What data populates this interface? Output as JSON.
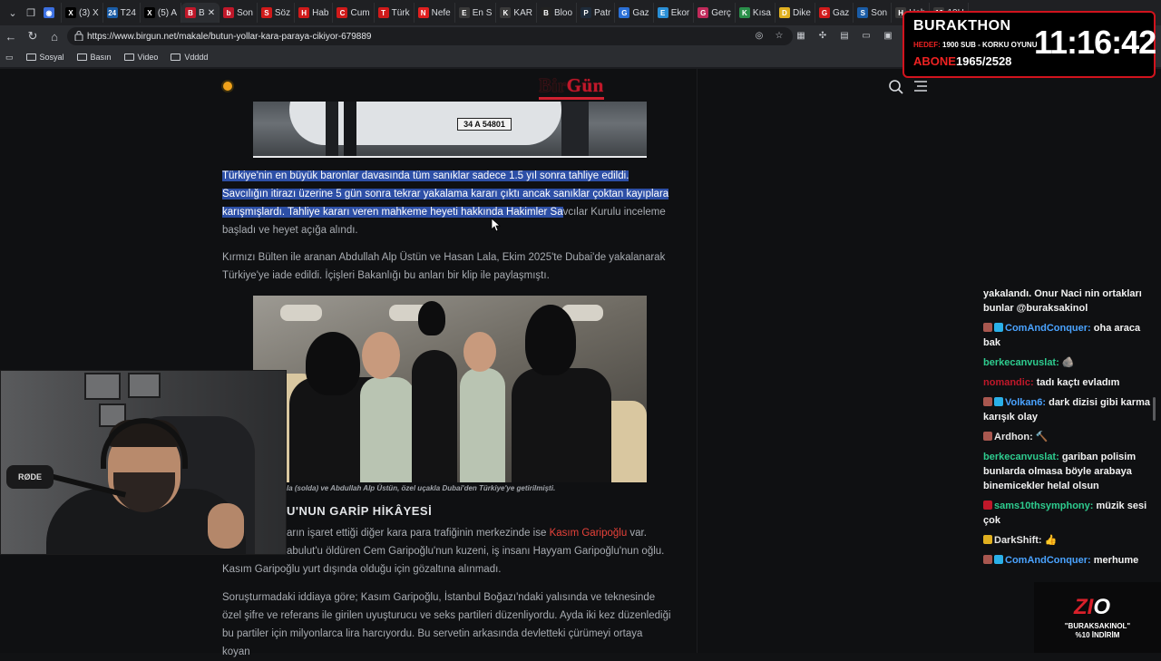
{
  "browser": {
    "tabs": [
      {
        "label": "",
        "color": "#3b6fe0",
        "glyph": "◉"
      },
      {
        "label": "(3) X",
        "color": "#000000",
        "glyph": "X"
      },
      {
        "label": "T24",
        "color": "#1a5ca6",
        "glyph": "24"
      },
      {
        "label": "(5) A",
        "color": "#000000",
        "glyph": "X"
      },
      {
        "label": "B",
        "color": "#c0182a",
        "glyph": "B",
        "active": true
      },
      {
        "label": "Son",
        "color": "#c0182a",
        "glyph": "b"
      },
      {
        "label": "Söz",
        "color": "#d01a1a",
        "glyph": "S"
      },
      {
        "label": "Hab",
        "color": "#d01a1a",
        "glyph": "H"
      },
      {
        "label": "Cum",
        "color": "#d01a1a",
        "glyph": "C"
      },
      {
        "label": "Türk",
        "color": "#d01a1a",
        "glyph": "T"
      },
      {
        "label": "Nefe",
        "color": "#e02020",
        "glyph": "N"
      },
      {
        "label": "En S",
        "color": "#3a3a3a",
        "glyph": "E"
      },
      {
        "label": "KAR",
        "color": "#3a3a3a",
        "glyph": "K"
      },
      {
        "label": "Bloo",
        "color": "#222222",
        "glyph": "B"
      },
      {
        "label": "Patr",
        "color": "#1e2b3a",
        "glyph": "P"
      },
      {
        "label": "Gaz",
        "color": "#2a6fd6",
        "glyph": "G"
      },
      {
        "label": "Ekor",
        "color": "#2a8fd6",
        "glyph": "E"
      },
      {
        "label": "Gerç",
        "color": "#c02a5a",
        "glyph": "G"
      },
      {
        "label": "Kısa",
        "color": "#2a8f4a",
        "glyph": "K"
      },
      {
        "label": "Dike",
        "color": "#e0b020",
        "glyph": "D"
      },
      {
        "label": "Gaz",
        "color": "#d01a1a",
        "glyph": "G"
      },
      {
        "label": "Son",
        "color": "#1a5ca6",
        "glyph": "S"
      },
      {
        "label": "Hab",
        "color": "#3a3a3a",
        "glyph": "H"
      },
      {
        "label": "10H",
        "color": "#3a3a3a",
        "glyph": "10"
      }
    ],
    "url": "https://www.birgun.net/makale/butun-yollar-kara-paraya-cikiyor-679889",
    "bookmarks": [
      "Sosyal",
      "Basın",
      "Video",
      "Vdddd"
    ]
  },
  "site": {
    "logo_prefix": "Bir",
    "logo_suffix": "Gün",
    "plate": "34 A 54801"
  },
  "article": {
    "p1_highlight": "Türkiye'nin en büyük baronlar davasında tüm sanıklar sadece 1.5 yıl sonra tahliye edildi. Savcılığın itirazı üzerine 5 gün sonra tekrar yakalama kararı çıktı ancak sanıklar çoktan kayıplara karışmışlardı. Tahliye kararı veren mahkeme heyeti hakkında Hakimler Sa",
    "p1_rest": "vcılar Kurulu inceleme başladı ve heyet açığa alındı.",
    "p2": "Kırmızı Bülten ile aranan Abdullah Alp Üstün ve Hasan Lala, Ekim 2025'te Dubai'de yakalanarak Türkiye'ye iade edildi. İçişleri Bakanlığı bu anları bir klip ile paylaşmıştı.",
    "caption": "la (solda) ve Abdullah Alp Üstün, özel uçakla Dubai'den Türkiye'ye getirilmişti.",
    "heading": "U'NUN GARİP HİKÂYESİ",
    "p3_a": "arın işaret ettiği diğer kara para trafiğinin merkezinde ise ",
    "p3_link": "Kasım Garipoğlu",
    "p3_b": " var.",
    "p3_c": "abulut'u öldüren Cem Garipoğlu'nun kuzeni, iş insanı Hayyam Garipoğlu'nun oğlu.",
    "p3_d": "Kasım Garipoğlu yurt dışında olduğu için gözaltına alınmadı.",
    "p4": "Soruşturmadaki iddiaya göre; Kasım Garipoğlu, İstanbul Boğazı'ndaki yalısında ve teknesinde özel şifre ve referans ile girilen uyuşturucu ve seks partileri düzenliyordu. Ayda iki kez düzenlediği bu partiler için milyonlarca lira harcıyordu. Bu servetin arkasında devletteki çürümeyi ortaya koyan"
  },
  "overlay": {
    "name": "BURAKTHON",
    "hedef_label": "HEDEF:",
    "hedef_value": "1900 SUB - KORKU OYUNU",
    "abone_label": "ABONE",
    "abone_value": "1965/2528",
    "time": "11:16:42",
    "webcam_mic": "RØDE"
  },
  "chat": [
    {
      "user": "",
      "color": "#ffffff",
      "text": "yakalandı. Onur Naci nin ortakları bunlar @buraksakinol",
      "badges": []
    },
    {
      "user": "ComAndConquer:",
      "color": "#4aa3ff",
      "text": "oha araca bak",
      "badges": [
        "#a8574f",
        "#2ab0e8"
      ]
    },
    {
      "user": "berkecanvuslat:",
      "color": "#2ecc8f",
      "text": "🪨",
      "badges": []
    },
    {
      "user": "nomandic:",
      "color": "#c0182a",
      "text": "tadı kaçtı evladım",
      "badges": []
    },
    {
      "user": "Volkan6:",
      "color": "#4aa3ff",
      "text": "dark dizisi gibi karma karışık olay",
      "badges": [
        "#a8574f",
        "#2ab0e8"
      ]
    },
    {
      "user": "Ardhon:",
      "color": "#e6e6e6",
      "text": "🔨",
      "badges": [
        "#a8574f"
      ]
    },
    {
      "user": "berkecanvuslat:",
      "color": "#2ecc8f",
      "text": "gariban polisim bunlarda olmasa böyle arabaya binemicekler helal olsun",
      "badges": []
    },
    {
      "user": "sams10thsymphony:",
      "color": "#2ecc8f",
      "text": "müzik sesi çok",
      "badges": [
        "#c0182a"
      ]
    },
    {
      "user": "DarkShift:",
      "color": "#e6e6e6",
      "text": "👍",
      "badges": [
        "#e0b020"
      ]
    },
    {
      "user": "ComAndConquer:",
      "color": "#4aa3ff",
      "text": "merhume",
      "badges": [
        "#a8574f",
        "#2ab0e8"
      ]
    }
  ],
  "sponsor": {
    "logo_a": "Z",
    "logo_b": "I",
    "logo_c": "O",
    "line1": "\"BURAKSAKINOL\"",
    "line2": "%10 İNDİRİM"
  }
}
